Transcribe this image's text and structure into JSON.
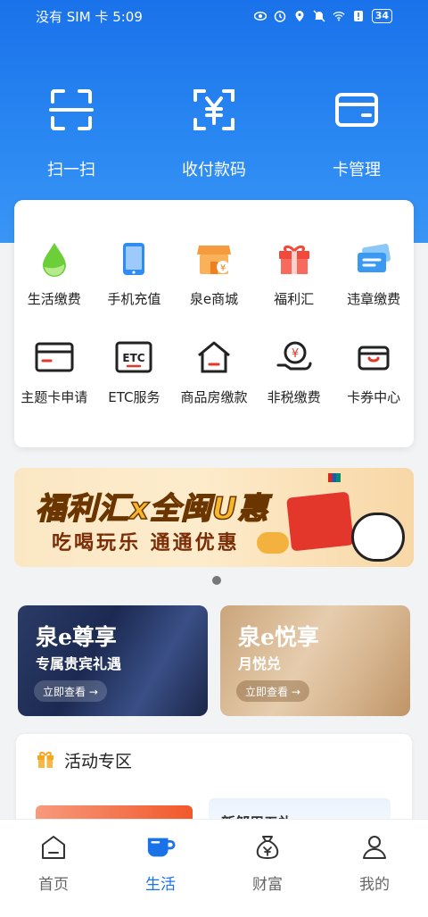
{
  "status_bar": {
    "carrier_time": "没有 SIM 卡 5:09",
    "battery": "34"
  },
  "quick_actions": [
    {
      "label": "扫一扫",
      "icon": "scan-icon"
    },
    {
      "label": "收付款码",
      "icon": "payment-code-icon"
    },
    {
      "label": "卡管理",
      "icon": "card-icon"
    }
  ],
  "services": {
    "row1": [
      {
        "label": "生活缴费",
        "icon": "water-drop-icon"
      },
      {
        "label": "手机充值",
        "icon": "phone-icon"
      },
      {
        "label": "泉e商城",
        "icon": "shop-icon"
      },
      {
        "label": "福利汇",
        "icon": "gift-icon"
      },
      {
        "label": "违章缴费",
        "icon": "ticket-icon"
      }
    ],
    "row2": [
      {
        "label": "主题卡申请",
        "icon": "theme-card-icon"
      },
      {
        "label": "ETC服务",
        "icon": "etc-icon"
      },
      {
        "label": "商品房缴款",
        "icon": "house-icon"
      },
      {
        "label": "非税缴费",
        "icon": "hand-coin-icon"
      },
      {
        "label": "卡券中心",
        "icon": "coupon-icon"
      }
    ],
    "etc_text": "ETC"
  },
  "banner": {
    "title": "福利汇x全闽U惠",
    "subtitle": "吃喝玩乐  通通优惠"
  },
  "promos": [
    {
      "title": "泉e尊享",
      "subtitle": "专属贵宾礼遇",
      "button": "立即查看 →"
    },
    {
      "title": "泉e悦享",
      "subtitle": "月悦兑",
      "button": "立即查看 →"
    }
  ],
  "activity": {
    "title": "活动专区",
    "card2_text": "新邹用五礼"
  },
  "tabbar": [
    {
      "label": "首页",
      "icon": "home-icon"
    },
    {
      "label": "生活",
      "icon": "cup-icon"
    },
    {
      "label": "财富",
      "icon": "money-bag-icon"
    },
    {
      "label": "我的",
      "icon": "user-icon"
    }
  ],
  "colors": {
    "primary": "#1a72ea",
    "background": "#f2f3f5"
  }
}
